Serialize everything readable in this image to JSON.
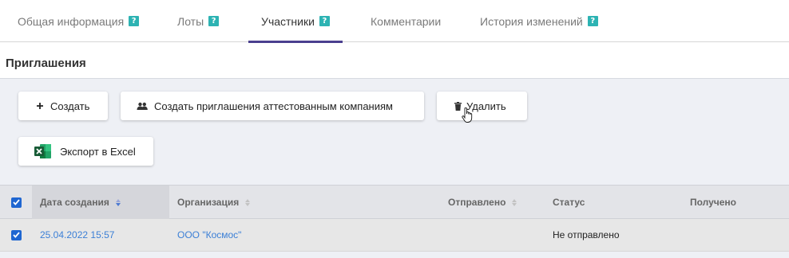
{
  "tabs": [
    {
      "label": "Общая информация",
      "help": "?"
    },
    {
      "label": "Лоты",
      "help": "?"
    },
    {
      "label": "Участники",
      "help": "?"
    },
    {
      "label": "Комментарии"
    },
    {
      "label": "История изменений",
      "help": "?"
    }
  ],
  "section": {
    "title": "Приглашения"
  },
  "toolbar": {
    "create_label": "Создать",
    "create_certified_label": "Создать приглашения аттестованным компаниям",
    "delete_label": "Удалить",
    "export_label": "Экспорт в Excel"
  },
  "table": {
    "columns": [
      "Дата создания",
      "Организация",
      "Отправлено",
      "Статус",
      "Получено"
    ],
    "rows": [
      {
        "date": "25.04.2022 15:57",
        "org": "ООО \"Космос\"",
        "sent": "",
        "status": "Не отправлено",
        "received": ""
      }
    ]
  },
  "colors": {
    "accent": "#4a3f8f",
    "link": "#3b7fd6",
    "help_badge": "#2db3b3",
    "checkbox": "#1f66d1"
  }
}
